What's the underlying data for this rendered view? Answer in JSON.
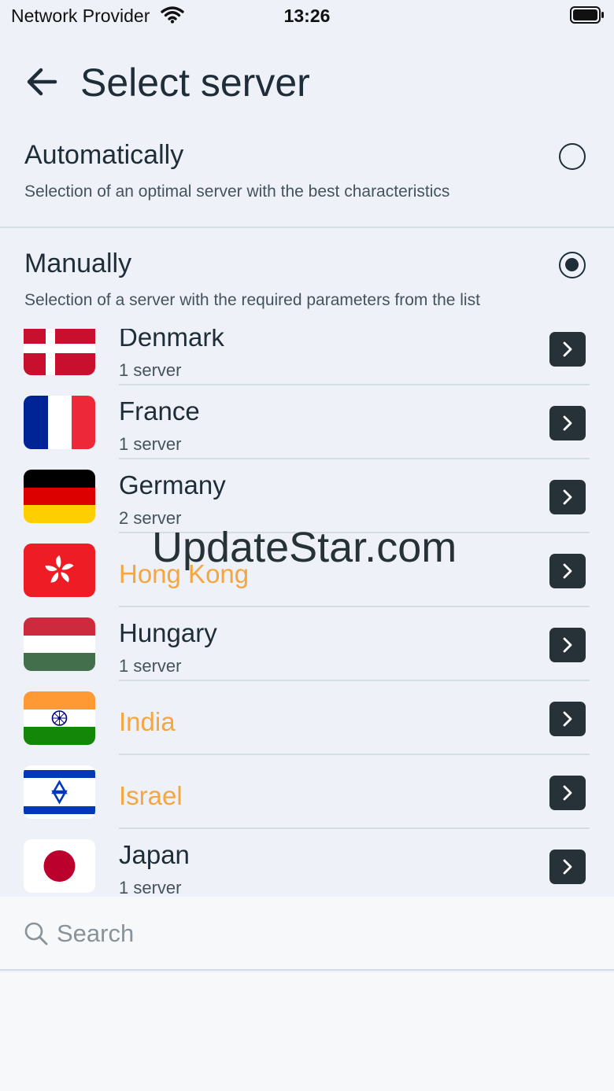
{
  "status_bar": {
    "carrier": "Network Provider",
    "time": "13:26"
  },
  "header": {
    "title": "Select server"
  },
  "modes": {
    "automatic": {
      "title": "Automatically",
      "description": "Selection of an optimal server with the best characteristics",
      "selected": false
    },
    "manual": {
      "title": "Manually",
      "description": "Selection of a server with the required parameters from the list",
      "selected": true
    }
  },
  "countries": [
    {
      "name": "Denmark",
      "sub": "1 server",
      "premium": false,
      "flag": "denmark-flag"
    },
    {
      "name": "France",
      "sub": "1 server",
      "premium": false,
      "flag": "france-flag"
    },
    {
      "name": "Germany",
      "sub": "2 server",
      "premium": false,
      "flag": "germany-flag"
    },
    {
      "name": "Hong Kong",
      "sub": "",
      "premium": true,
      "flag": "hong-kong-flag"
    },
    {
      "name": "Hungary",
      "sub": "1 server",
      "premium": false,
      "flag": "hungary-flag"
    },
    {
      "name": "India",
      "sub": "",
      "premium": true,
      "flag": "india-flag"
    },
    {
      "name": "Israel",
      "sub": "",
      "premium": true,
      "flag": "israel-flag"
    },
    {
      "name": "Japan",
      "sub": "1 server",
      "premium": false,
      "flag": "japan-flag"
    }
  ],
  "search": {
    "placeholder": "Search",
    "value": ""
  },
  "watermark": "UpdateStar.com",
  "colors": {
    "premium": "#f5a641",
    "primary": "#263238",
    "background": "#eef2f8"
  }
}
